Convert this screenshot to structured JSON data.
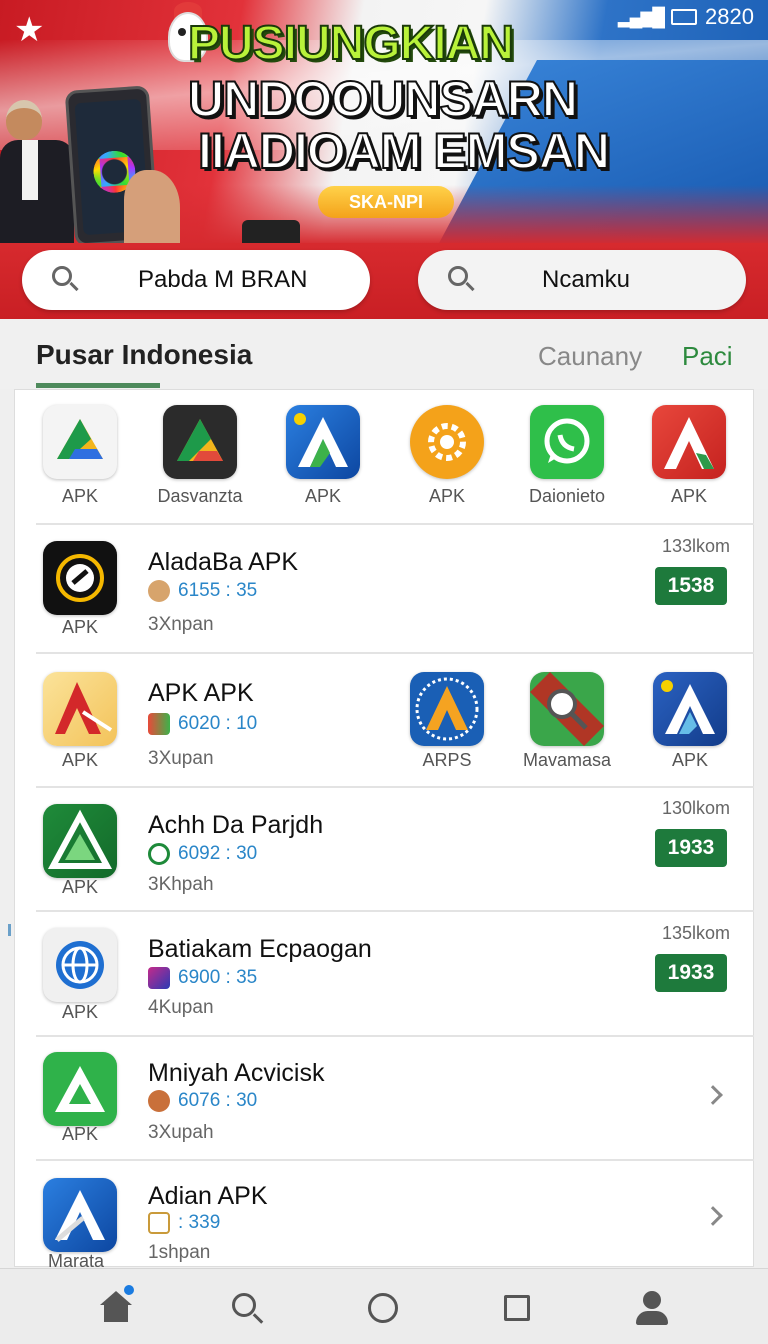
{
  "status_bar": {
    "time": "2820"
  },
  "banner": {
    "headline_1": "PUSIUNGKIAN",
    "headline_2": "UNDOOUNSARN",
    "headline_3": "IIADIOAM EMSAN",
    "promo_label": "SKA-NPI"
  },
  "search": {
    "box_1": "Pabda M BRAN",
    "box_2": "Ncamku"
  },
  "tabs": {
    "main": "Pusar Indonesia",
    "second": "Caunany",
    "third": "Paci"
  },
  "featured_apps": [
    {
      "label": "APK",
      "icon": "drive-triangle-icon"
    },
    {
      "label": "Dasvanzta",
      "icon": "drive-dark-icon"
    },
    {
      "label": "APK",
      "icon": "blue-a-icon"
    },
    {
      "label": "APK",
      "icon": "orange-gear-icon"
    },
    {
      "label": "Daionieto",
      "icon": "whatsapp-icon"
    },
    {
      "label": "APK",
      "icon": "red-a-icon"
    }
  ],
  "rows": [
    {
      "title": "AladaBa APK",
      "meta": "6155 : 35",
      "sub": "3Xnpan",
      "count": "133lkom",
      "action": "1538",
      "icon_label": "APK",
      "icon": "speed-ring-icon"
    },
    {
      "title": "APK APK",
      "meta": "6020 : 10",
      "sub": "3Xupan",
      "icon_label": "APK",
      "icon": "red-a-yellow-icon",
      "extra_apps": [
        {
          "label": "ARPS",
          "icon": "circuit-a-icon"
        },
        {
          "label": "Mavamasa",
          "icon": "magnifier-app-icon"
        },
        {
          "label": "APK",
          "icon": "blue-a-star-icon"
        }
      ]
    },
    {
      "title": "Achh Da Parjdh",
      "meta": "6092 : 30",
      "sub": "3Khpah",
      "count": "130lkom",
      "action": "1933",
      "icon_label": "APK",
      "icon": "green-a-icon"
    },
    {
      "title": "Batiakam Ecpaogan",
      "meta": "6900 : 35",
      "sub": "4Kupan",
      "count": "135lkom",
      "action": "1933",
      "icon_label": "APK",
      "icon": "globe-icon"
    },
    {
      "title": "Mniyah Acvicisk",
      "meta": "6076 : 30",
      "sub": "3Xupah",
      "icon_label": "APK",
      "icon": "green-triangle-icon"
    },
    {
      "title": "Adian APK",
      "meta": ": 339",
      "sub": "1shpan",
      "icon_label": "Marata",
      "icon": "blue-a-pen-icon"
    }
  ],
  "colors": {
    "accent_red": "#d72a2e",
    "accent_green": "#1e7a3c",
    "meta_blue": "#2a86c8",
    "tab_green": "#2d8a3e"
  },
  "bottom_nav": [
    "home-icon",
    "search-icon",
    "circle-icon",
    "square-icon",
    "profile-icon"
  ]
}
